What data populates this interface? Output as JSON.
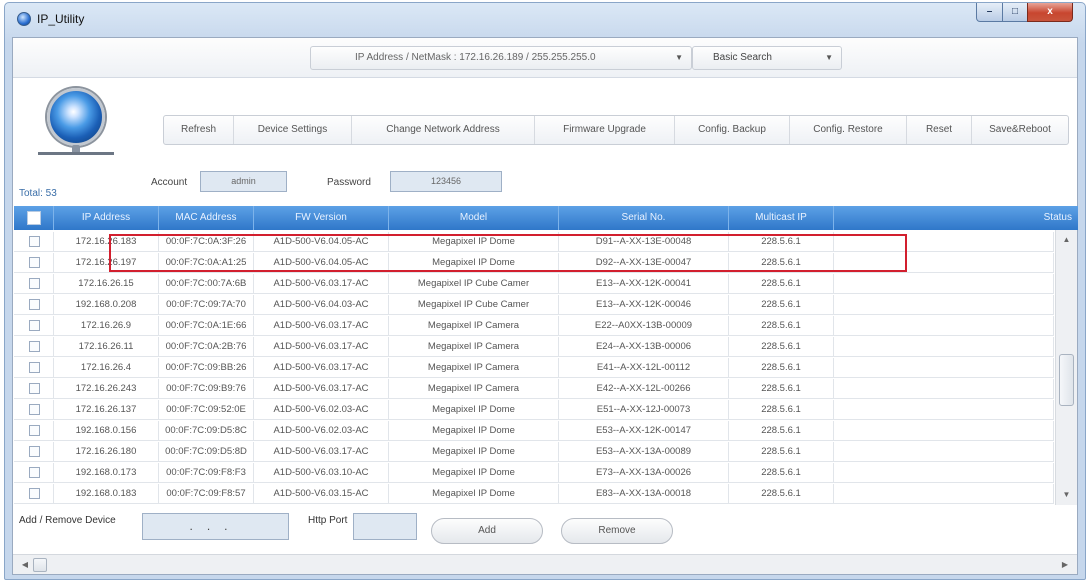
{
  "window": {
    "title": "IP_Utility",
    "controls": {
      "minimize": "–",
      "maximize": "□",
      "close": "x"
    }
  },
  "toolbar": {
    "address_dropdown": "IP Address / NetMask : 172.16.26.189 / 255.255.255.0",
    "search_dropdown": "Basic Search"
  },
  "actions": [
    {
      "label": "Refresh"
    },
    {
      "label": "Device Settings"
    },
    {
      "label": "Change Network Address"
    },
    {
      "label": "Firmware Upgrade"
    },
    {
      "label": "Config. Backup"
    },
    {
      "label": "Config. Restore"
    },
    {
      "label": "Reset"
    },
    {
      "label": "Save&Reboot"
    }
  ],
  "credentials": {
    "account_label": "Account",
    "account_value": "admin",
    "password_label": "Password",
    "password_value": "123456"
  },
  "total": "Total: 53",
  "table": {
    "columns": [
      "IP Address",
      "MAC Address",
      "FW Version",
      "Model",
      "Serial No.",
      "Multicast IP",
      "Status"
    ],
    "rows": [
      {
        "ip": "172.16.26.183",
        "mac": "00:0F:7C:0A:3F:26",
        "fw": "A1D-500-V6.04.05-AC",
        "model": "Megapixel IP Dome",
        "serial": "D91--A-XX-13E-00048",
        "multicast": "228.5.6.1",
        "status": ""
      },
      {
        "ip": "172.16.26.197",
        "mac": "00:0F:7C:0A:A1:25",
        "fw": "A1D-500-V6.04.05-AC",
        "model": "Megapixel IP Dome",
        "serial": "D92--A-XX-13E-00047",
        "multicast": "228.5.6.1",
        "status": ""
      },
      {
        "ip": "172.16.26.15",
        "mac": "00:0F:7C:00:7A:6B",
        "fw": "A1D-500-V6.03.17-AC",
        "model": "Megapixel IP Cube Camer",
        "serial": "E13--A-XX-12K-00041",
        "multicast": "228.5.6.1",
        "status": ""
      },
      {
        "ip": "192.168.0.208",
        "mac": "00:0F:7C:09:7A:70",
        "fw": "A1D-500-V6.04.03-AC",
        "model": "Megapixel IP Cube Camer",
        "serial": "E13--A-XX-12K-00046",
        "multicast": "228.5.6.1",
        "status": ""
      },
      {
        "ip": "172.16.26.9",
        "mac": "00:0F:7C:0A:1E:66",
        "fw": "A1D-500-V6.03.17-AC",
        "model": "Megapixel IP Camera",
        "serial": "E22--A0XX-13B-00009",
        "multicast": "228.5.6.1",
        "status": ""
      },
      {
        "ip": "172.16.26.11",
        "mac": "00:0F:7C:0A:2B:76",
        "fw": "A1D-500-V6.03.17-AC",
        "model": "Megapixel IP Camera",
        "serial": "E24--A-XX-13B-00006",
        "multicast": "228.5.6.1",
        "status": ""
      },
      {
        "ip": "172.16.26.4",
        "mac": "00:0F:7C:09:BB:26",
        "fw": "A1D-500-V6.03.17-AC",
        "model": "Megapixel IP Camera",
        "serial": "E41--A-XX-12L-00112",
        "multicast": "228.5.6.1",
        "status": ""
      },
      {
        "ip": "172.16.26.243",
        "mac": "00:0F:7C:09:B9:76",
        "fw": "A1D-500-V6.03.17-AC",
        "model": "Megapixel IP Camera",
        "serial": "E42--A-XX-12L-00266",
        "multicast": "228.5.6.1",
        "status": ""
      },
      {
        "ip": "172.16.26.137",
        "mac": "00:0F:7C:09:52:0E",
        "fw": "A1D-500-V6.02.03-AC",
        "model": "Megapixel IP Dome",
        "serial": "E51--A-XX-12J-00073",
        "multicast": "228.5.6.1",
        "status": ""
      },
      {
        "ip": "192.168.0.156",
        "mac": "00:0F:7C:09:D5:8C",
        "fw": "A1D-500-V6.02.03-AC",
        "model": "Megapixel IP Dome",
        "serial": "E53--A-XX-12K-00147",
        "multicast": "228.5.6.1",
        "status": ""
      },
      {
        "ip": "172.16.26.180",
        "mac": "00:0F:7C:09:D5:8D",
        "fw": "A1D-500-V6.03.17-AC",
        "model": "Megapixel IP Dome",
        "serial": "E53--A-XX-13A-00089",
        "multicast": "228.5.6.1",
        "status": ""
      },
      {
        "ip": "192.168.0.173",
        "mac": "00:0F:7C:09:F8:F3",
        "fw": "A1D-500-V6.03.10-AC",
        "model": "Megapixel IP Dome",
        "serial": "E73--A-XX-13A-00026",
        "multicast": "228.5.6.1",
        "status": ""
      },
      {
        "ip": "192.168.0.183",
        "mac": "00:0F:7C:09:F8:57",
        "fw": "A1D-500-V6.03.15-AC",
        "model": "Megapixel IP Dome",
        "serial": "E83--A-XX-13A-00018",
        "multicast": "228.5.6.1",
        "status": ""
      }
    ]
  },
  "device_panel": {
    "add_remove_label": "Add / Remove Device",
    "ip_value": "...",
    "http_port_label": "Http Port",
    "http_port_value": "",
    "add_label": "Add",
    "remove_label": "Remove"
  },
  "scroll": {
    "up": "▲",
    "down": "▼",
    "left": "◀",
    "right": "▶"
  },
  "icons": {
    "header_check": "checkbox-icon",
    "globe": "globe-network-icon"
  },
  "colors": {
    "header": "#3a84d4",
    "highlight": "#d21f2e",
    "total": "#3a6ea8"
  }
}
